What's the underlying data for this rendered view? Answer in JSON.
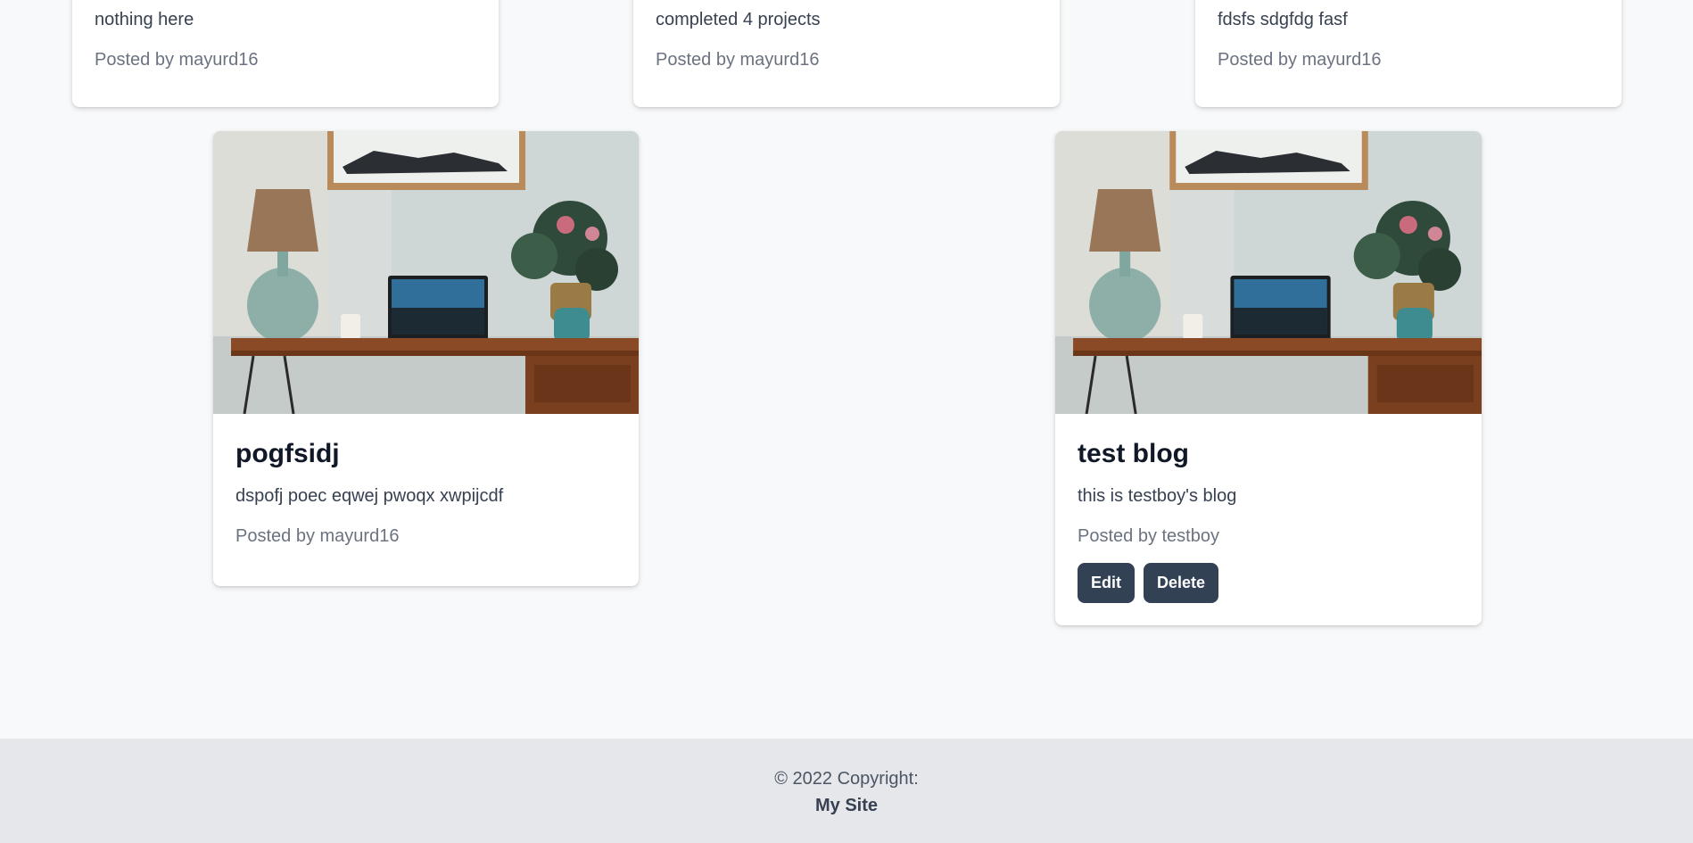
{
  "posts_top": [
    {
      "description": "nothing here",
      "author": "Posted by mayurd16"
    },
    {
      "description": "completed 4 projects",
      "author": "Posted by mayurd16"
    },
    {
      "description": "fdsfs sdgfdg fasf",
      "author": "Posted by mayurd16"
    }
  ],
  "posts": [
    {
      "title": "pogfsidj",
      "description": "dspofj poec eqwej pwoqx xwpijcdf",
      "author": "Posted by mayurd16"
    },
    {
      "title": "test blog",
      "description": "this is testboy's blog",
      "author": "Posted by testboy",
      "edit_label": "Edit",
      "delete_label": "Delete"
    }
  ],
  "footer": {
    "copyright": "© 2022 Copyright:",
    "site_name": "My Site"
  },
  "colors": {
    "button_bg": "#334155",
    "page_bg": "#f8f9fa",
    "footer_bg": "#e5e7eb"
  }
}
